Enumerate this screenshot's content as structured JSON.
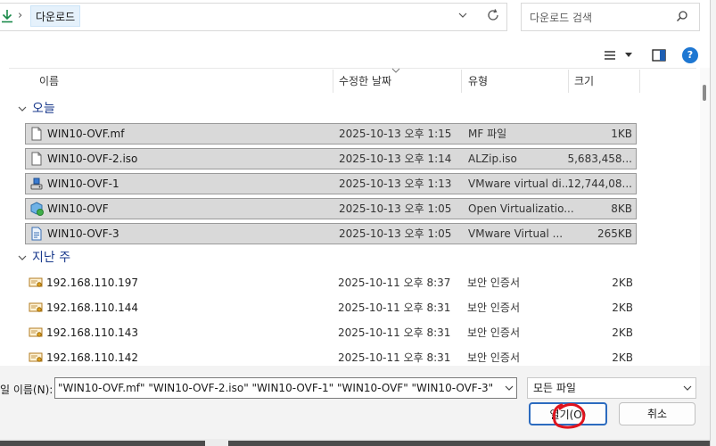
{
  "address": {
    "icon": "download-arrow-icon",
    "separator": "›",
    "crumb": "다운로드"
  },
  "search": {
    "placeholder": "다운로드 검색"
  },
  "columns": {
    "name": "이름",
    "date": "수정한 날짜",
    "type": "유형",
    "size": "크기"
  },
  "groups": {
    "today": "오늘",
    "last_week": "지난 주"
  },
  "files_today": [
    {
      "name": "WIN10-OVF.mf",
      "date": "2025-10-13 오후 1:15",
      "type": "MF 파일",
      "size": "1KB",
      "icon": "document-icon"
    },
    {
      "name": "WIN10-OVF-2.iso",
      "date": "2025-10-13 오후 1:14",
      "type": "ALZip.iso",
      "size": "5,683,458...",
      "icon": "document-icon"
    },
    {
      "name": "WIN10-OVF-1",
      "date": "2025-10-13 오후 1:13",
      "type": "VMware virtual di...",
      "size": "12,744,08...",
      "icon": "vmware-disk-icon"
    },
    {
      "name": "WIN10-OVF",
      "date": "2025-10-13 오후 1:05",
      "type": "Open Virtualizatio...",
      "size": "8KB",
      "icon": "ovf-package-icon"
    },
    {
      "name": "WIN10-OVF-3",
      "date": "2025-10-13 오후 1:05",
      "type": "VMware Virtual ...",
      "size": "265KB",
      "icon": "vmx-file-icon"
    }
  ],
  "files_last_week": [
    {
      "name": "192.168.110.197",
      "date": "2025-10-11 오후 8:37",
      "type": "보안 인증서",
      "size": "2KB",
      "icon": "certificate-icon"
    },
    {
      "name": "192.168.110.144",
      "date": "2025-10-11 오후 8:31",
      "type": "보안 인증서",
      "size": "2KB",
      "icon": "certificate-icon"
    },
    {
      "name": "192.168.110.143",
      "date": "2025-10-11 오후 8:31",
      "type": "보안 인증서",
      "size": "2KB",
      "icon": "certificate-icon"
    },
    {
      "name": "192.168.110.142",
      "date": "2025-10-11 오후 8:31",
      "type": "보안 인증서",
      "size": "2KB",
      "icon": "certificate-icon"
    }
  ],
  "footer": {
    "filename_label": "일 이름(N):",
    "filename_value": "\"WIN10-OVF.mf\" \"WIN10-OVF-2.iso\" \"WIN10-OVF-1\" \"WIN10-OVF\" \"WIN10-OVF-3\"",
    "filetype_value": "모든 파일",
    "open_label": "열기(O)",
    "cancel_label": "취소"
  },
  "toolbar": {
    "help_label": "?"
  },
  "colors": {
    "accent": "#1e77d2",
    "selection": "#d9d9d9",
    "annotation": "#e0141e",
    "group_text": "#1a3a8c"
  }
}
